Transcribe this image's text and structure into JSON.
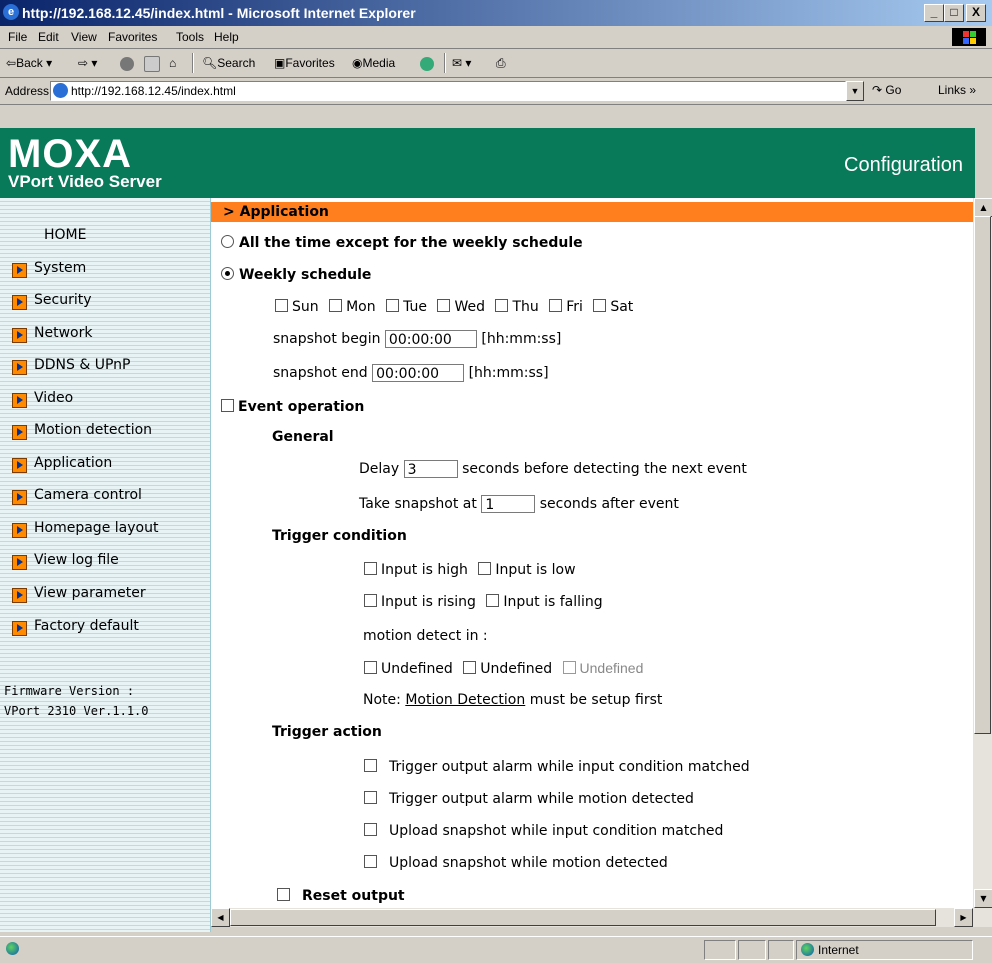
{
  "window": {
    "title": "http://192.168.12.45/index.html - Microsoft Internet Explorer",
    "min": "_",
    "max": "□",
    "close": "X"
  },
  "menu": [
    "File",
    "Edit",
    "View",
    "Favorites",
    "Tools",
    "Help"
  ],
  "toolbar": {
    "back": "Back",
    "search": "Search",
    "favorites": "Favorites",
    "media": "Media"
  },
  "address": {
    "label": "Address",
    "url": "http://192.168.12.45/index.html",
    "go": "Go",
    "links": "Links »"
  },
  "header": {
    "logo": "MOXA",
    "subtitle": "VPort Video Server",
    "right": "Configuration"
  },
  "sidebar": {
    "home": "HOME",
    "items": [
      "System",
      "Security",
      "Network",
      "DDNS & UPnP",
      "Video",
      "Motion detection",
      "Application",
      "Camera control",
      "Homepage layout",
      "View log file",
      "View parameter",
      "Factory default"
    ],
    "firmware_label": "Firmware Version :",
    "firmware_value": "VPort 2310 Ver.1.1.0"
  },
  "content": {
    "section": "> Application",
    "opt_all_time": "All the time except for the weekly schedule",
    "opt_weekly": "Weekly schedule",
    "days": [
      "Sun",
      "Mon",
      "Tue",
      "Wed",
      "Thu",
      "Fri",
      "Sat"
    ],
    "snap_begin_label": "snapshot begin",
    "snap_begin_value": "00:00:00",
    "snap_end_label": "snapshot end",
    "snap_end_value": "00:00:00",
    "time_hint": "[hh:mm:ss]",
    "event_operation": "Event operation",
    "general": "General",
    "delay_label": "Delay",
    "delay_value": "3",
    "delay_suffix": "seconds before detecting the next event",
    "take_label": "Take snapshot at",
    "take_value": "1",
    "take_suffix": "seconds after event",
    "trigger_condition": "Trigger condition",
    "input_high": "Input is high",
    "input_low": "Input is low",
    "input_rising": "Input is rising",
    "input_falling": "Input is falling",
    "motion_in": "motion detect in :",
    "undefined_1": "Undefined",
    "undefined_2": "Undefined",
    "undefined_3": "Undefined",
    "note_prefix": "Note:",
    "note_link": "Motion Detection",
    "note_suffix": "must be setup first",
    "trigger_action": "Trigger action",
    "act1": "Trigger output alarm while input condition matched",
    "act2": "Trigger output alarm while motion detected",
    "act3": "Upload snapshot while input condition matched",
    "act4": "Upload snapshot while motion detected",
    "reset_output": "Reset output"
  },
  "status": {
    "zone": "Internet"
  }
}
